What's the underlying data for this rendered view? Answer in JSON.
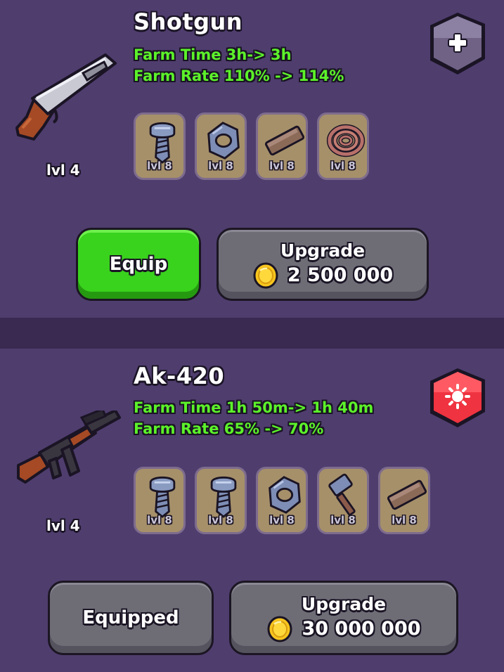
{
  "weapons": [
    {
      "name": "Shotgun",
      "farm_time": "Farm Time 3h-> 3h",
      "farm_rate": "Farm Rate 110% -> 114%",
      "level": "lvl 4",
      "badge_icon": "plus-icon",
      "badge_color": "#6f6285",
      "materials": [
        {
          "icon": "screw-icon",
          "level": "lvl 8"
        },
        {
          "icon": "nut-icon",
          "level": "lvl 8"
        },
        {
          "icon": "wood-plank-icon",
          "level": "lvl 8"
        },
        {
          "icon": "rope-coil-icon",
          "level": "lvl 8"
        }
      ],
      "action_label": "Equip",
      "upgrade_label": "Upgrade",
      "upgrade_price": "2 500 000"
    },
    {
      "name": "Ak-420",
      "farm_time": "Farm Time 1h 50m-> 1h 40m",
      "farm_rate": "Farm Rate 65% -> 70%",
      "level": "lvl 4",
      "badge_icon": "sun-icon",
      "badge_color": "#ef3340",
      "materials": [
        {
          "icon": "screw-icon",
          "level": "lvl 8"
        },
        {
          "icon": "screw-icon",
          "level": "lvl 8"
        },
        {
          "icon": "nut-icon",
          "level": "lvl 8"
        },
        {
          "icon": "hammer-icon",
          "level": "lvl 8"
        },
        {
          "icon": "wood-plank-icon",
          "level": "lvl 8"
        }
      ],
      "action_label": "Equipped",
      "upgrade_label": "Upgrade",
      "upgrade_price": "30 000 000"
    }
  ],
  "colors": {
    "background": "#4f3d6e",
    "stat_green": "#5cf22a",
    "equip_green": "#39d21d",
    "button_grey": "#6e6d76",
    "coin_gold": "#f7c51e"
  }
}
